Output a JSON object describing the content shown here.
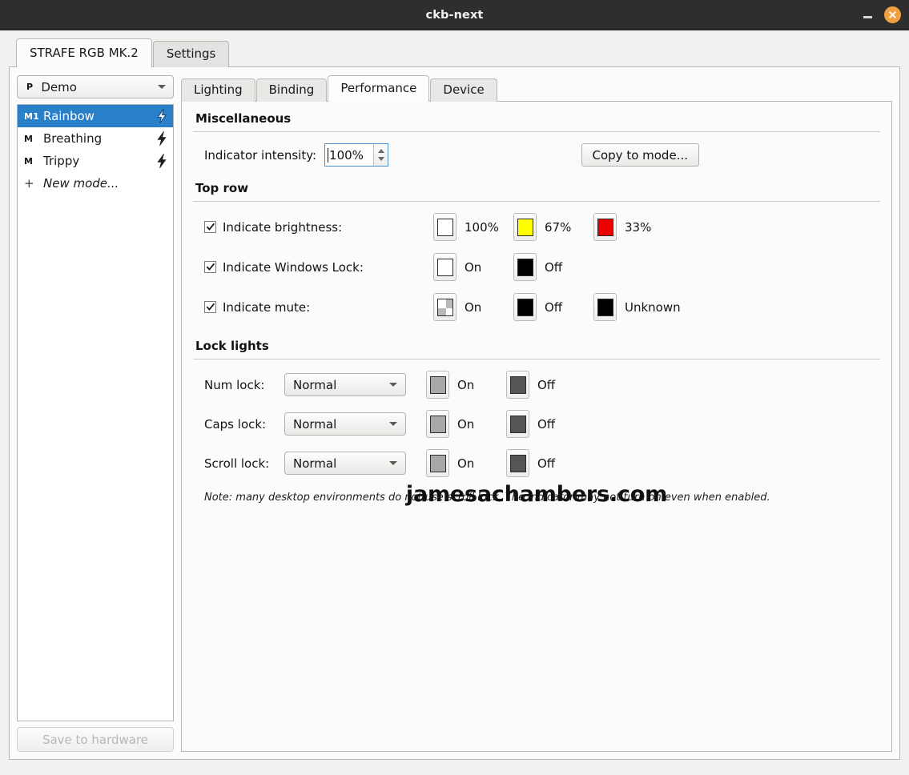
{
  "window": {
    "title": "ckb-next",
    "minimize_icon": "minimize-icon",
    "close_icon": "close-icon"
  },
  "top_tabs": [
    {
      "label": "STRAFE RGB MK.2",
      "active": true
    },
    {
      "label": "Settings",
      "active": false
    }
  ],
  "sidebar": {
    "profile": {
      "badge": "P",
      "name": "Demo",
      "caret_icon": "chevron-down-icon"
    },
    "modes": [
      {
        "badge": "M1",
        "label": "Rainbow",
        "selected": true,
        "icon": "lightning-bolt-icon"
      },
      {
        "badge": "M",
        "label": "Breathing",
        "selected": false,
        "icon": "lightning-bolt-icon"
      },
      {
        "badge": "M",
        "label": "Trippy",
        "selected": false,
        "icon": "lightning-bolt-icon"
      },
      {
        "badge": "+",
        "label": "New mode...",
        "selected": false,
        "icon": ""
      }
    ],
    "save_button": {
      "label": "Save to hardware",
      "enabled": false
    }
  },
  "sub_tabs": [
    {
      "label": "Lighting",
      "active": false
    },
    {
      "label": "Binding",
      "active": false
    },
    {
      "label": "Performance",
      "active": true
    },
    {
      "label": "Device",
      "active": false
    }
  ],
  "performance": {
    "miscellaneous": {
      "title": "Miscellaneous",
      "intensity_label": "Indicator intensity:",
      "intensity_value": "100%",
      "copy_button": "Copy to mode..."
    },
    "top_row": {
      "title": "Top row",
      "rows": [
        {
          "label": "Indicate brightness:",
          "checked": true,
          "swatches": [
            {
              "label": "100%",
              "color": "#ffffff"
            },
            {
              "label": "67%",
              "color": "#ffff00"
            },
            {
              "label": "33%",
              "color": "#ee0000"
            }
          ]
        },
        {
          "label": "Indicate Windows Lock:",
          "checked": true,
          "swatches": [
            {
              "label": "On",
              "color": "#ffffff"
            },
            {
              "label": "Off",
              "color": "#000000"
            }
          ]
        },
        {
          "label": "Indicate mute:",
          "checked": true,
          "swatches": [
            {
              "label": "On",
              "color": "transparent"
            },
            {
              "label": "Off",
              "color": "#000000"
            },
            {
              "label": "Unknown",
              "color": "#000000"
            }
          ]
        }
      ]
    },
    "lock_lights": {
      "title": "Lock lights",
      "rows": [
        {
          "label": "Num lock:",
          "mode": "Normal",
          "swatches": [
            {
              "label": "On",
              "color": "#a8a8a8"
            },
            {
              "label": "Off",
              "color": "#555555"
            }
          ]
        },
        {
          "label": "Caps lock:",
          "mode": "Normal",
          "swatches": [
            {
              "label": "On",
              "color": "#a8a8a8"
            },
            {
              "label": "Off",
              "color": "#555555"
            }
          ]
        },
        {
          "label": "Scroll lock:",
          "mode": "Normal",
          "swatches": [
            {
              "label": "On",
              "color": "#a8a8a8"
            },
            {
              "label": "Off",
              "color": "#555555"
            }
          ]
        }
      ],
      "note": "Note: many desktop environments do not use scroll lock. The indicator may not turn on even when enabled."
    }
  },
  "watermark": "jamesachambers.com",
  "colors": {
    "titlebar_bg": "#2e2e2e",
    "close_button": "#f0a040",
    "selection_blue": "#2a7fc9",
    "focus_border": "#4d8fc9"
  }
}
